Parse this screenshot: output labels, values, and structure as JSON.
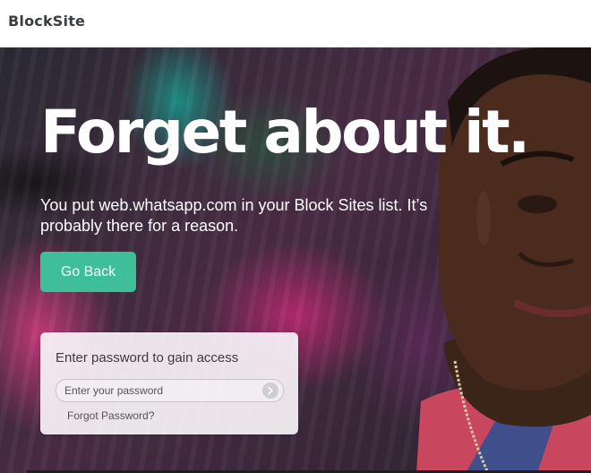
{
  "header": {
    "logo": "BlockSite"
  },
  "main": {
    "headline": "Forget about it.",
    "message": "You put web.whatsapp.com in your Block Sites list. It’s probably there for a reason.",
    "go_back_label": "Go Back"
  },
  "password": {
    "title": "Enter password to gain access",
    "placeholder": "Enter your password",
    "value": "",
    "forgot_label": "Forgot Password?",
    "submit_icon": "arrow-right-icon"
  },
  "colors": {
    "accent": "#3fbf99",
    "headline": "#ffffff",
    "logo": "#3a3d42"
  }
}
